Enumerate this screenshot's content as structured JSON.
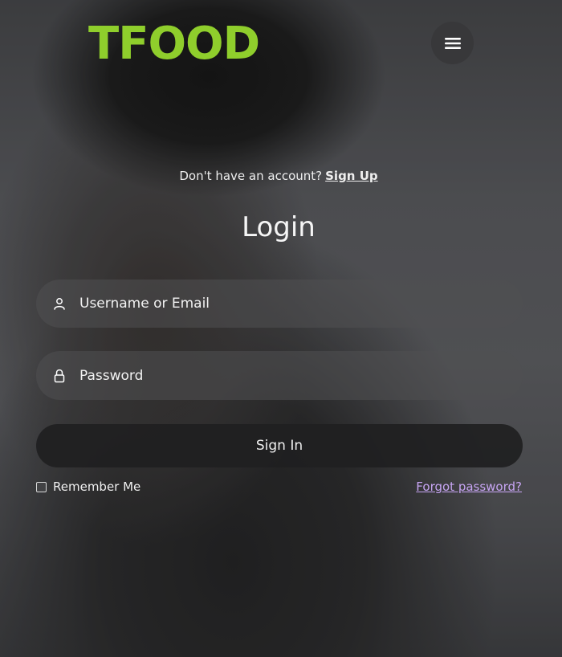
{
  "brand": {
    "name": "TFOOD",
    "color": "#8fce2c"
  },
  "header": {
    "menu_icon": "hamburger-menu-icon"
  },
  "signup": {
    "prompt": "Don't have an account?",
    "link_label": "Sign Up"
  },
  "form": {
    "title": "Login",
    "username_placeholder": "Username or Email",
    "username_icon": "user-icon",
    "password_placeholder": "Password",
    "password_icon": "lock-icon",
    "submit_label": "Sign In",
    "remember_label": "Remember Me",
    "remember_checked": false,
    "forgot_label": "Forgot password?",
    "forgot_color": "#c6a4f2"
  }
}
